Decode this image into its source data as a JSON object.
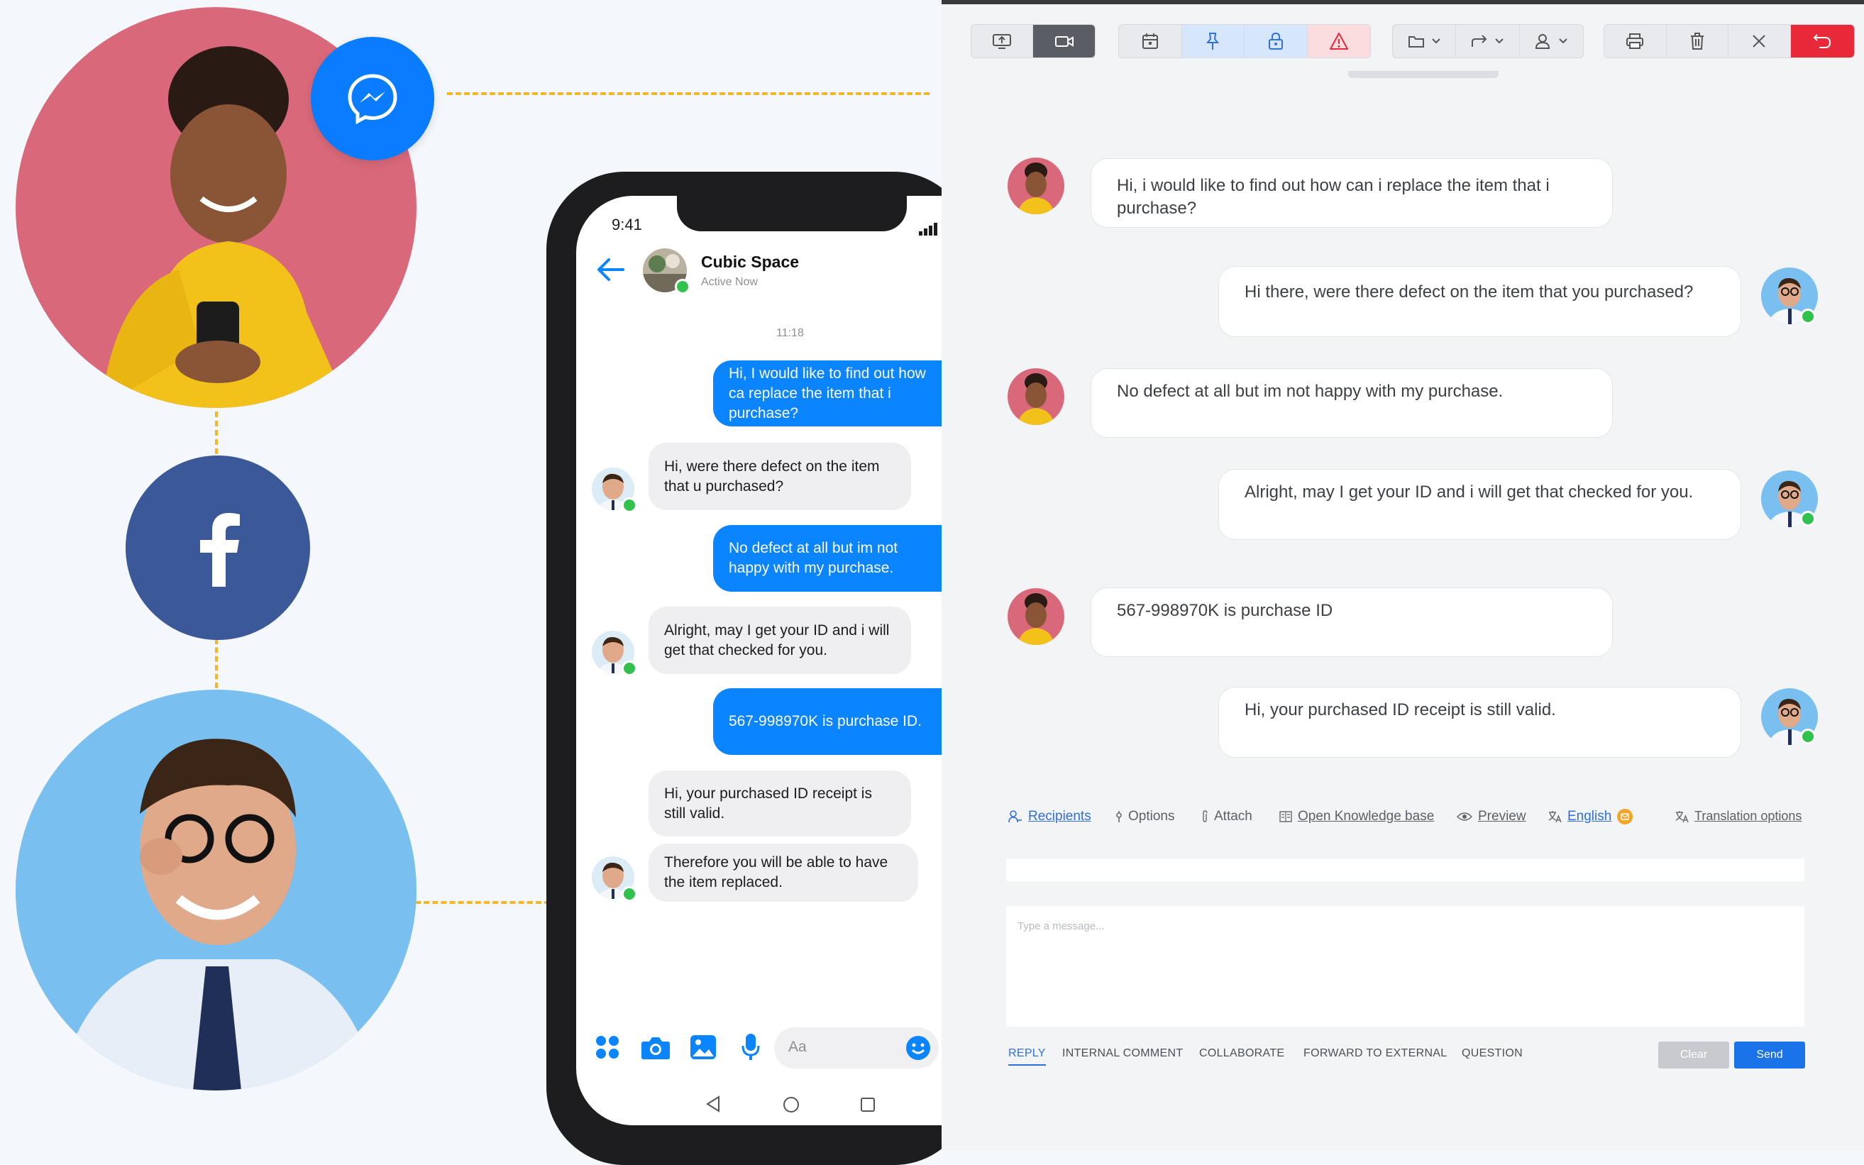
{
  "phone": {
    "time": "9:41",
    "contact_name": "Cubic Space",
    "contact_status": "Active Now",
    "timestamp": "11:18",
    "composer_placeholder": "Aa",
    "messages": [
      {
        "from": "customer",
        "text": "Hi, I would like to find out how ca replace the item that i purchase?"
      },
      {
        "from": "agent",
        "text": "Hi, were there defect on the item that u purchased?"
      },
      {
        "from": "customer",
        "text": "No defect at all but im not happy with my purchase."
      },
      {
        "from": "agent",
        "text": "Alright, may I get your ID and i will get that checked for you."
      },
      {
        "from": "customer",
        "text": "567-998970K is purchase ID."
      },
      {
        "from": "agent",
        "text": "Hi, your purchased ID receipt is still valid."
      },
      {
        "from": "agent",
        "text": "Therefore you will be able to have the item replaced."
      }
    ]
  },
  "ticket": {
    "messages": [
      {
        "from": "customer",
        "text": "Hi, i would like to find out how can i replace the item that i purchase?"
      },
      {
        "from": "agent",
        "text": "Hi there, were there defect on the item that you purchased?"
      },
      {
        "from": "customer",
        "text": "No defect at all but im not happy with my purchase."
      },
      {
        "from": "agent",
        "text": "Alright, may I get your ID and i will get that checked for you."
      },
      {
        "from": "customer",
        "text": "567-998970K is purchase ID"
      },
      {
        "from": "agent",
        "text": "Hi, your purchased ID receipt is still valid."
      }
    ],
    "options": {
      "recipients": "Recipients",
      "options": "Options",
      "attach": "Attach",
      "knowledge_base": "Open Knowledge base",
      "preview": "Preview",
      "language": "English",
      "translation": "Translation options"
    },
    "composer_placeholder": "Type a message...",
    "tabs": [
      "REPLY",
      "INTERNAL COMMENT",
      "COLLABORATE",
      "FORWARD TO EXTERNAL",
      "QUESTION"
    ],
    "clear_label": "Clear",
    "send_label": "Send"
  },
  "colors": {
    "messenger_blue": "#0a84ff",
    "facebook_blue": "#3b5998",
    "accent_yellow": "#f5b62c",
    "send_blue": "#1a73e8",
    "danger_red": "#e8293a"
  },
  "icons": [
    "messenger-icon",
    "facebook-icon",
    "back-arrow-icon",
    "apps-icon",
    "camera-icon",
    "gallery-icon",
    "microphone-icon",
    "emoji-icon",
    "monitor-upload-icon",
    "video-icon",
    "calendar-icon",
    "pin-icon",
    "lock-icon",
    "warning-icon",
    "folder-icon",
    "forward-icon",
    "assign-user-icon",
    "print-icon",
    "trash-icon",
    "close-icon",
    "undo-icon"
  ]
}
